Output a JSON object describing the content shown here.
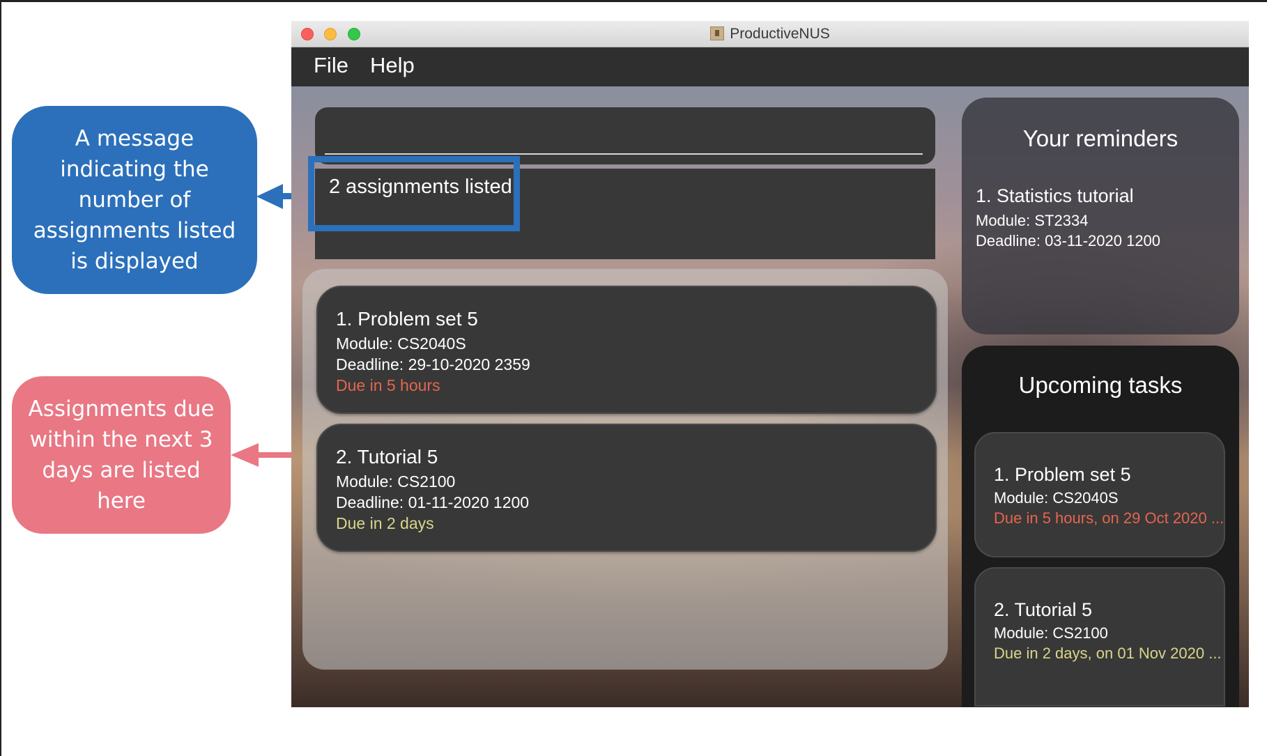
{
  "colors": {
    "due_urgent": "#e6654f",
    "due_soon": "#d9d68a",
    "callout_blue": "#2c70bb",
    "callout_pink": "#e97784"
  },
  "callouts": {
    "message": "A message indicating the number of assignments listed is displayed",
    "due_soon": "Assignments due within the next 3 days are listed here"
  },
  "window": {
    "title": "ProductiveNUS"
  },
  "menu": {
    "file": "File",
    "help": "Help"
  },
  "command": {
    "value": ""
  },
  "result": {
    "message": "2 assignments listed!"
  },
  "assignments": [
    {
      "title": "1.  Problem set 5",
      "module": "Module: CS2040S",
      "deadline": "Deadline: 29-10-2020 2359",
      "due": "Due in 5 hours"
    },
    {
      "title": "2.  Tutorial 5",
      "module": "Module: CS2100",
      "deadline": "Deadline: 01-11-2020 1200",
      "due": "Due in 2 days"
    }
  ],
  "reminders": {
    "heading": "Your reminders",
    "items": [
      {
        "title": "1.  Statistics tutorial",
        "module": "Module: ST2334",
        "deadline": "Deadline: 03-11-2020 1200"
      }
    ]
  },
  "upcoming": {
    "heading": "Upcoming tasks",
    "items": [
      {
        "title": "1.  Problem set 5",
        "module": "Module: CS2040S",
        "due": "Due in 5 hours, on 29 Oct 2020 ..."
      },
      {
        "title": "2.  Tutorial 5",
        "module": "Module: CS2100",
        "due": "Due in 2 days, on 01 Nov 2020 ..."
      }
    ]
  }
}
